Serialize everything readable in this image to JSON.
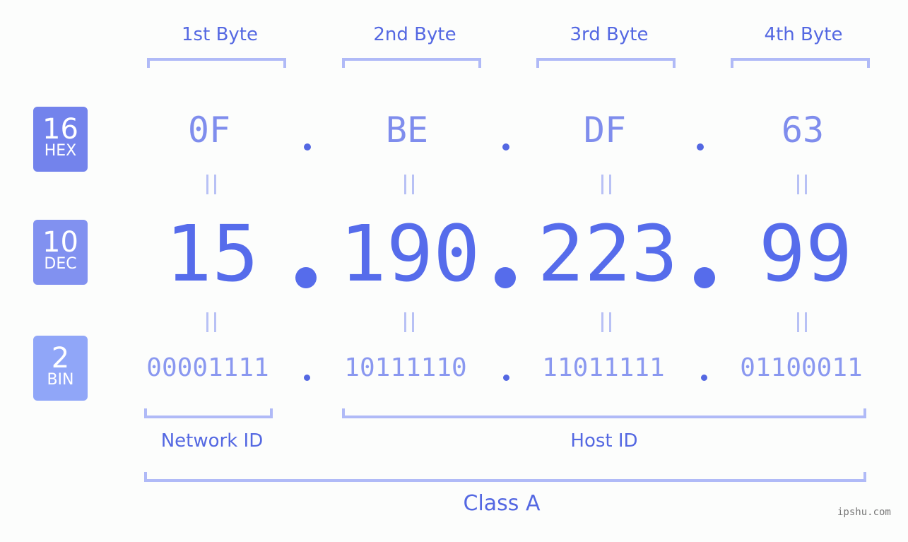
{
  "header": {
    "bytes": [
      "1st Byte",
      "2nd Byte",
      "3rd Byte",
      "4th Byte"
    ]
  },
  "badges": {
    "hex": {
      "num": "16",
      "label": "HEX",
      "color": "#7383ec"
    },
    "dec": {
      "num": "10",
      "label": "DEC",
      "color": "#8191f0"
    },
    "bin": {
      "num": "2",
      "label": "BIN",
      "color": "#90a6f8"
    }
  },
  "ip": {
    "hex": [
      "0F",
      "BE",
      "DF",
      "63"
    ],
    "dec": [
      "15",
      "190",
      "223",
      "99"
    ],
    "bin": [
      "00001111",
      "10111110",
      "11011111",
      "01100011"
    ],
    "separator": "."
  },
  "segments": {
    "network": "Network ID",
    "host": "Host ID",
    "class": "Class A"
  },
  "watermark": "ipshu.com",
  "colors": {
    "accent": "#566ceb",
    "bracket": "#b0baf7",
    "hex_text": "#7f8ded",
    "bin_text": "#8a98f0"
  }
}
